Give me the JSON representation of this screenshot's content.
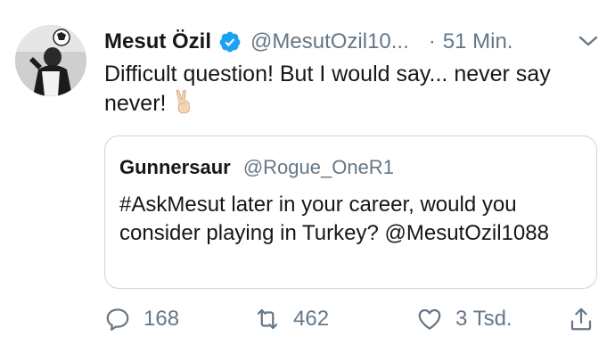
{
  "tweet": {
    "author_name": "Mesut Özil",
    "handle": "@MesutOzil10...",
    "separator": "·",
    "time": "51 Min.",
    "text": "Difficult question! But I would say... never say never!"
  },
  "quoted_tweet": {
    "author_name": "Gunnersaur",
    "handle": "@Rogue_OneR1",
    "text": "#AskMesut later in your career, would you consider playing in Turkey? @MesutOzil1088"
  },
  "actions": {
    "reply_count": "168",
    "retweet_count": "462",
    "like_count": "3 Tsd."
  },
  "colors": {
    "verified": "#1da1f2",
    "secondary_text": "#657786",
    "border": "#ccd6dd"
  },
  "icons": [
    "verified-badge-icon",
    "chevron-down-icon",
    "victory-hand-emoji",
    "reply-icon",
    "retweet-icon",
    "like-icon",
    "share-icon"
  ]
}
